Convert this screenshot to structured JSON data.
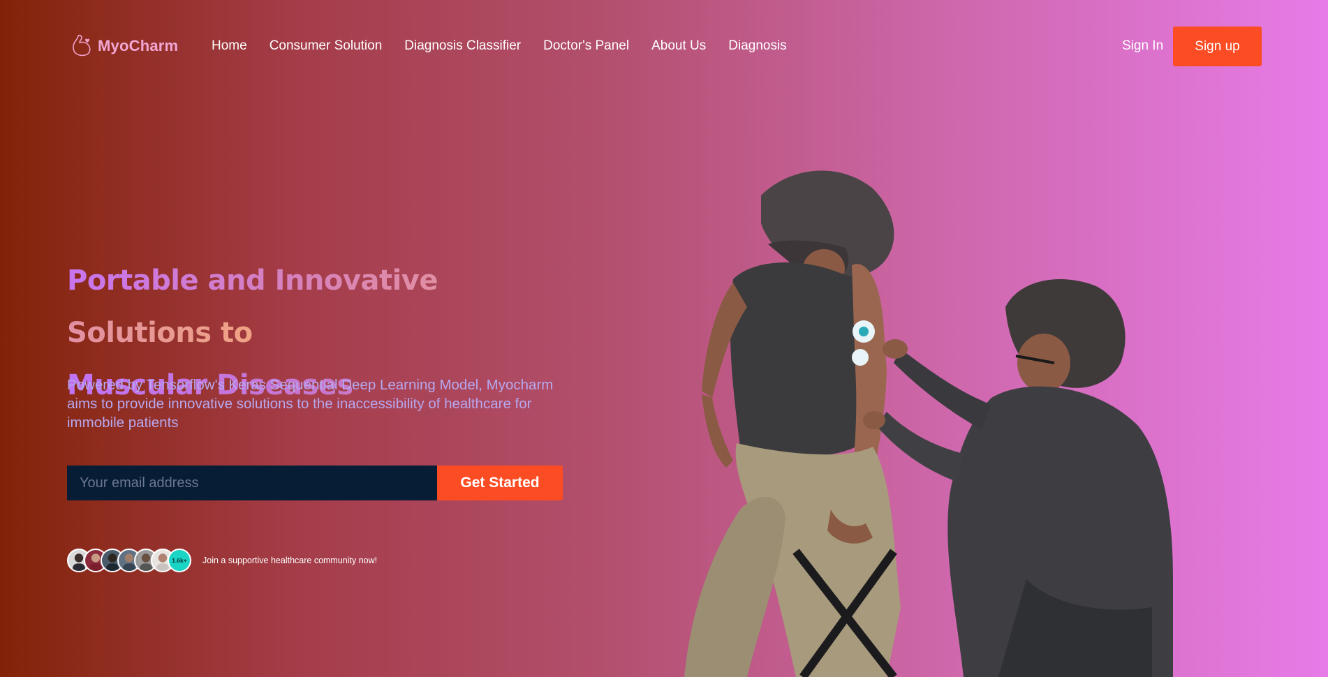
{
  "brand": {
    "name": "MyoCharm",
    "logo_icon": "flexed-arm-heart-icon",
    "color": "#f2a6d3"
  },
  "nav": {
    "items": [
      "Home",
      "Consumer Solution",
      "Diagnosis Classifier",
      "Doctor's Panel",
      "About Us",
      "Diagnosis"
    ],
    "sign_in": "Sign In",
    "sign_up": "Sign up"
  },
  "hero": {
    "headline_line1": "Portable and Innovative Solutions to",
    "headline_line2": "Muscular Diseases",
    "subtext": "Powered by Tensorflow's Keras Sequential Deep Learning Model, Myocharm aims to provide innovative solutions to the inaccessibility of healthcare for immobile patients",
    "email_placeholder": "Your email address",
    "cta": "Get Started"
  },
  "community": {
    "count_badge": "1.6k+",
    "text": "Join a supportive healthcare community now!",
    "avatar_count": 6
  },
  "colors": {
    "accent": "#fc4c24",
    "input_bg": "#071c35",
    "badge": "#1ad4c4",
    "subtext": "#b7a8f0"
  }
}
